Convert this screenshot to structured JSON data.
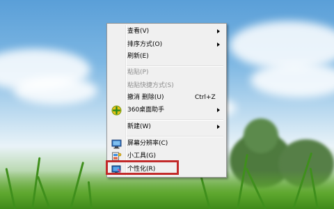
{
  "context_menu": {
    "items": [
      {
        "label": "查看(V)",
        "shortcut": "",
        "submenu": true,
        "disabled": false
      },
      {
        "label": "排序方式(O)",
        "shortcut": "",
        "submenu": true,
        "disabled": false
      },
      {
        "label": "刷新(E)",
        "shortcut": "",
        "submenu": false,
        "disabled": false
      },
      {
        "label": "粘贴(P)",
        "shortcut": "",
        "submenu": false,
        "disabled": true
      },
      {
        "label": "粘贴快捷方式(S)",
        "shortcut": "",
        "submenu": false,
        "disabled": true
      },
      {
        "label": "撤消 删除(U)",
        "shortcut": "Ctrl+Z",
        "submenu": false,
        "disabled": false
      },
      {
        "label": "360桌面助手",
        "shortcut": "",
        "submenu": true,
        "disabled": false,
        "icon": "360-assistant-icon"
      },
      {
        "label": "新建(W)",
        "shortcut": "",
        "submenu": true,
        "disabled": false
      },
      {
        "label": "屏幕分辨率(C)",
        "shortcut": "",
        "submenu": false,
        "disabled": false,
        "icon": "screen-resolution-icon"
      },
      {
        "label": "小工具(G)",
        "shortcut": "",
        "submenu": false,
        "disabled": false,
        "icon": "gadgets-icon"
      },
      {
        "label": "个性化(R)",
        "shortcut": "",
        "submenu": false,
        "disabled": false,
        "icon": "personalize-icon"
      }
    ]
  },
  "colors": {
    "highlight_border": "#c22a2a",
    "disabled_text": "#8d8d8d",
    "menu_background": "#f0f0f0"
  }
}
